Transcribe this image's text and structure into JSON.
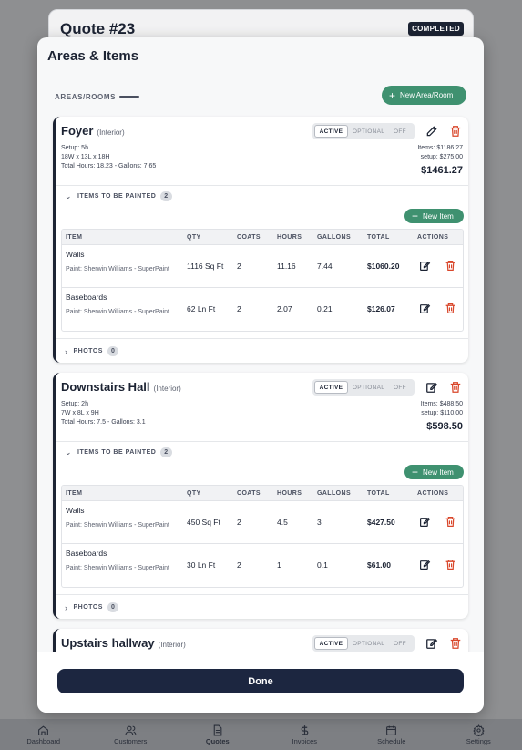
{
  "background": {
    "quote_title": "Quote #23",
    "status_badge": "COMPLETED"
  },
  "bottom_nav": [
    {
      "label": "Dashboard",
      "icon": "home-icon"
    },
    {
      "label": "Customers",
      "icon": "users-icon"
    },
    {
      "label": "Quotes",
      "icon": "document-icon",
      "active": true
    },
    {
      "label": "Invoices",
      "icon": "dollar-icon"
    },
    {
      "label": "Schedule",
      "icon": "calendar-icon"
    },
    {
      "label": "Settings",
      "icon": "gear-icon"
    }
  ],
  "modal": {
    "title": "Areas & Items",
    "section_label": "AREAS/ROOMS",
    "new_area_label": "New Area/Room",
    "done_label": "Done"
  },
  "segments": {
    "active": "ACTIVE",
    "optional": "OPTIONAL",
    "off": "OFF"
  },
  "table_headers": {
    "item": "ITEM",
    "qty": "QTY",
    "coats": "COATS",
    "hours": "HOURS",
    "gallons": "GALLONS",
    "total": "TOTAL",
    "actions": "ACTIONS"
  },
  "labels": {
    "items_to_paint": "ITEMS TO BE PAINTED",
    "photos": "PHOTOS",
    "new_item": "New Item"
  },
  "areas": [
    {
      "name": "Foyer",
      "type": "(Interior)",
      "setup": "Setup: 5h",
      "dimensions": "18W x 13L x 18H",
      "hours_gallons": "Total Hours: 18.23 - Gallons: 7.65",
      "items_total": "Items: $1186.27",
      "setup_total": "setup: $275.00",
      "grand_total": "$1461.27",
      "item_count": "2",
      "photo_count": "0",
      "items": [
        {
          "name": "Walls",
          "paint": "Paint: Sherwin Williams - SuperPaint",
          "qty": "1116 Sq Ft",
          "coats": "2",
          "hours": "11.16",
          "gallons": "7.44",
          "total": "$1060.20"
        },
        {
          "name": "Baseboards",
          "paint": "Paint: Sherwin Williams - SuperPaint",
          "qty": "62 Ln Ft",
          "coats": "2",
          "hours": "2.07",
          "gallons": "0.21",
          "total": "$126.07"
        }
      ]
    },
    {
      "name": "Downstairs Hall",
      "type": "(Interior)",
      "setup": "Setup: 2h",
      "dimensions": "7W x 8L x 9H",
      "hours_gallons": "Total Hours: 7.5 - Gallons: 3.1",
      "items_total": "Items: $488.50",
      "setup_total": "setup: $110.00",
      "grand_total": "$598.50",
      "item_count": "2",
      "photo_count": "0",
      "items": [
        {
          "name": "Walls",
          "paint": "Paint: Sherwin Williams - SuperPaint",
          "qty": "450 Sq Ft",
          "coats": "2",
          "hours": "4.5",
          "gallons": "3",
          "total": "$427.50"
        },
        {
          "name": "Baseboards",
          "paint": "Paint: Sherwin Williams - SuperPaint",
          "qty": "30 Ln Ft",
          "coats": "2",
          "hours": "1",
          "gallons": "0.1",
          "total": "$61.00"
        }
      ]
    },
    {
      "name": "Upstairs hallway",
      "type": "(Interior)"
    }
  ],
  "colors": {
    "primary": "#1c2640",
    "green": "#3f9170",
    "delete": "#d9472b"
  }
}
